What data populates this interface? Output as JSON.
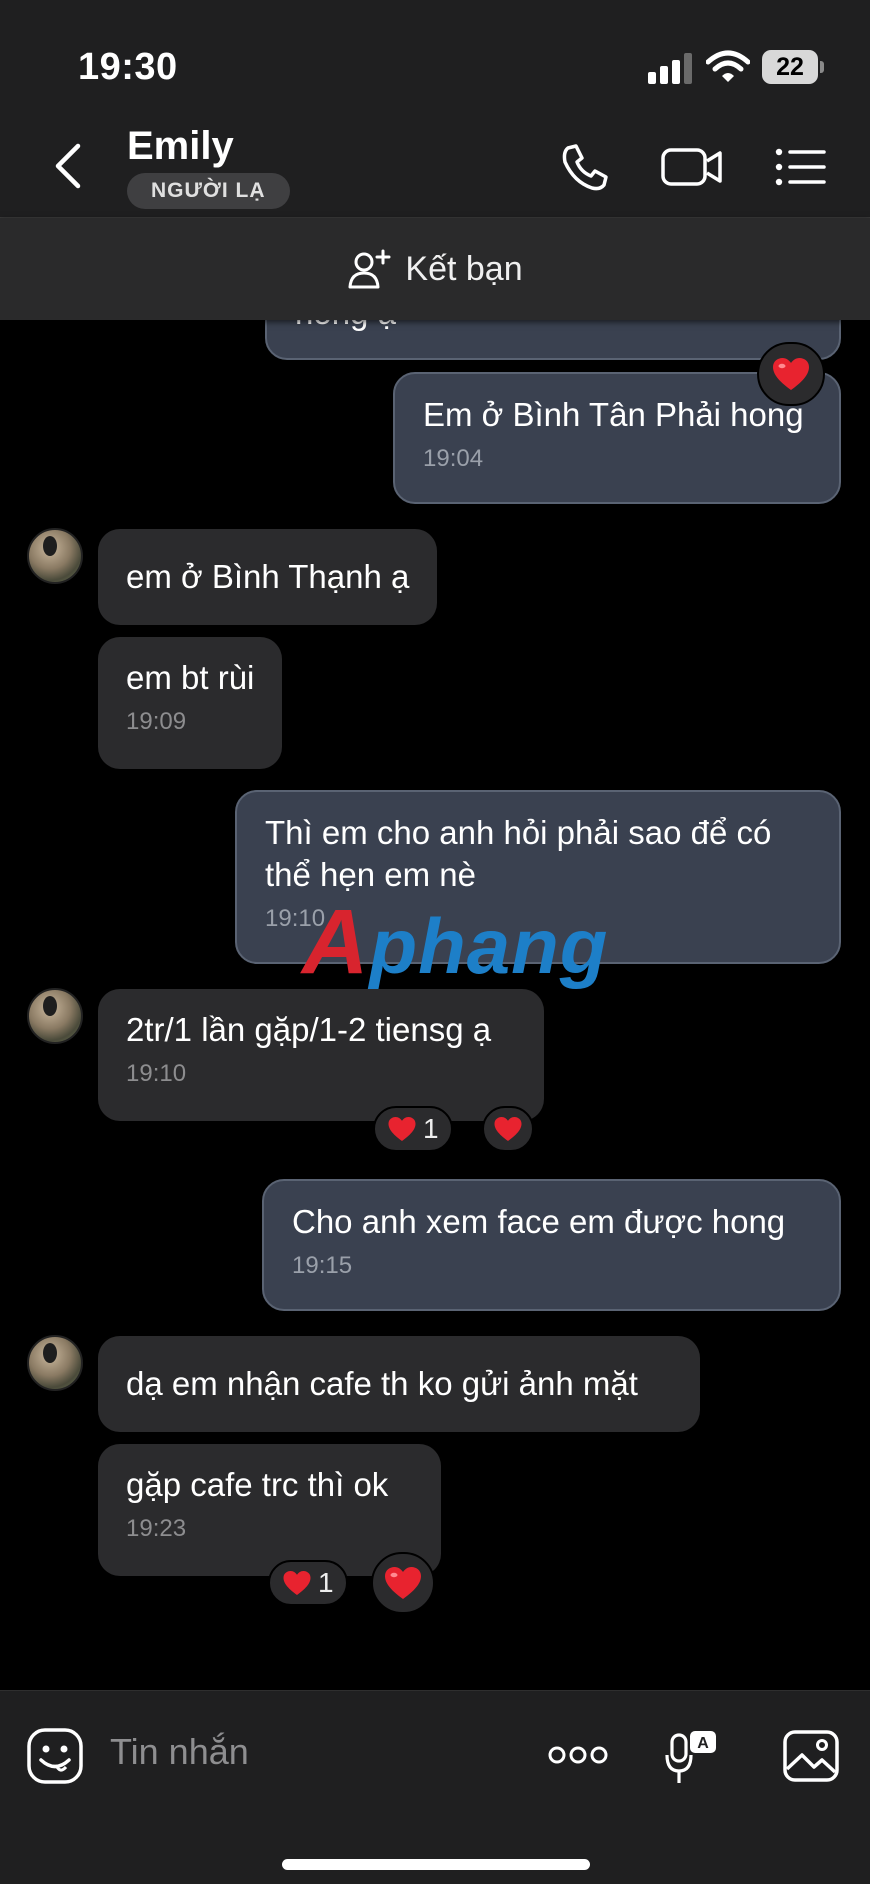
{
  "status_bar": {
    "time": "19:30",
    "battery": "22"
  },
  "header": {
    "contact_name": "Emily",
    "badge": "NGƯỜI LẠ",
    "icons": [
      "back-chevron-icon",
      "phone-icon",
      "video-camera-icon",
      "list-menu-icon"
    ]
  },
  "add_friend": {
    "label": "Kết bạn",
    "icon": "add-person-icon"
  },
  "messages": [
    {
      "side": "out",
      "text": "hong ạ",
      "time": ""
    },
    {
      "side": "out",
      "text": "Em ở Bình Tân Phải hong",
      "time": "19:04",
      "reaction": "❤"
    },
    {
      "side": "in",
      "text": "em ở Bình Thạnh ạ",
      "time": ""
    },
    {
      "side": "in",
      "text": "em bt rùi",
      "time": "19:09"
    },
    {
      "side": "out",
      "text": "Thì em cho anh hỏi phải sao để có thể hẹn em nè",
      "time": "19:10"
    },
    {
      "side": "in",
      "text": "2tr/1 lần gặp/1-2 tiensg ạ",
      "time": "19:10",
      "reaction_count": "1"
    },
    {
      "side": "out",
      "text": "Cho anh xem face em được hong",
      "time": "19:15"
    },
    {
      "side": "in",
      "text": "dạ em nhận cafe th ko gửi ảnh mặt",
      "time": ""
    },
    {
      "side": "in",
      "text": "gặp cafe trc thì ok",
      "time": "19:23",
      "reaction_count": "1"
    }
  ],
  "watermark": {
    "first": "A",
    "rest": "phang"
  },
  "composer": {
    "placeholder": "Tin nhắn"
  },
  "colors": {
    "incoming": "#2b2b2d",
    "outgoing": "#3a4150",
    "heart": "#e8232f",
    "background": "#000000"
  }
}
